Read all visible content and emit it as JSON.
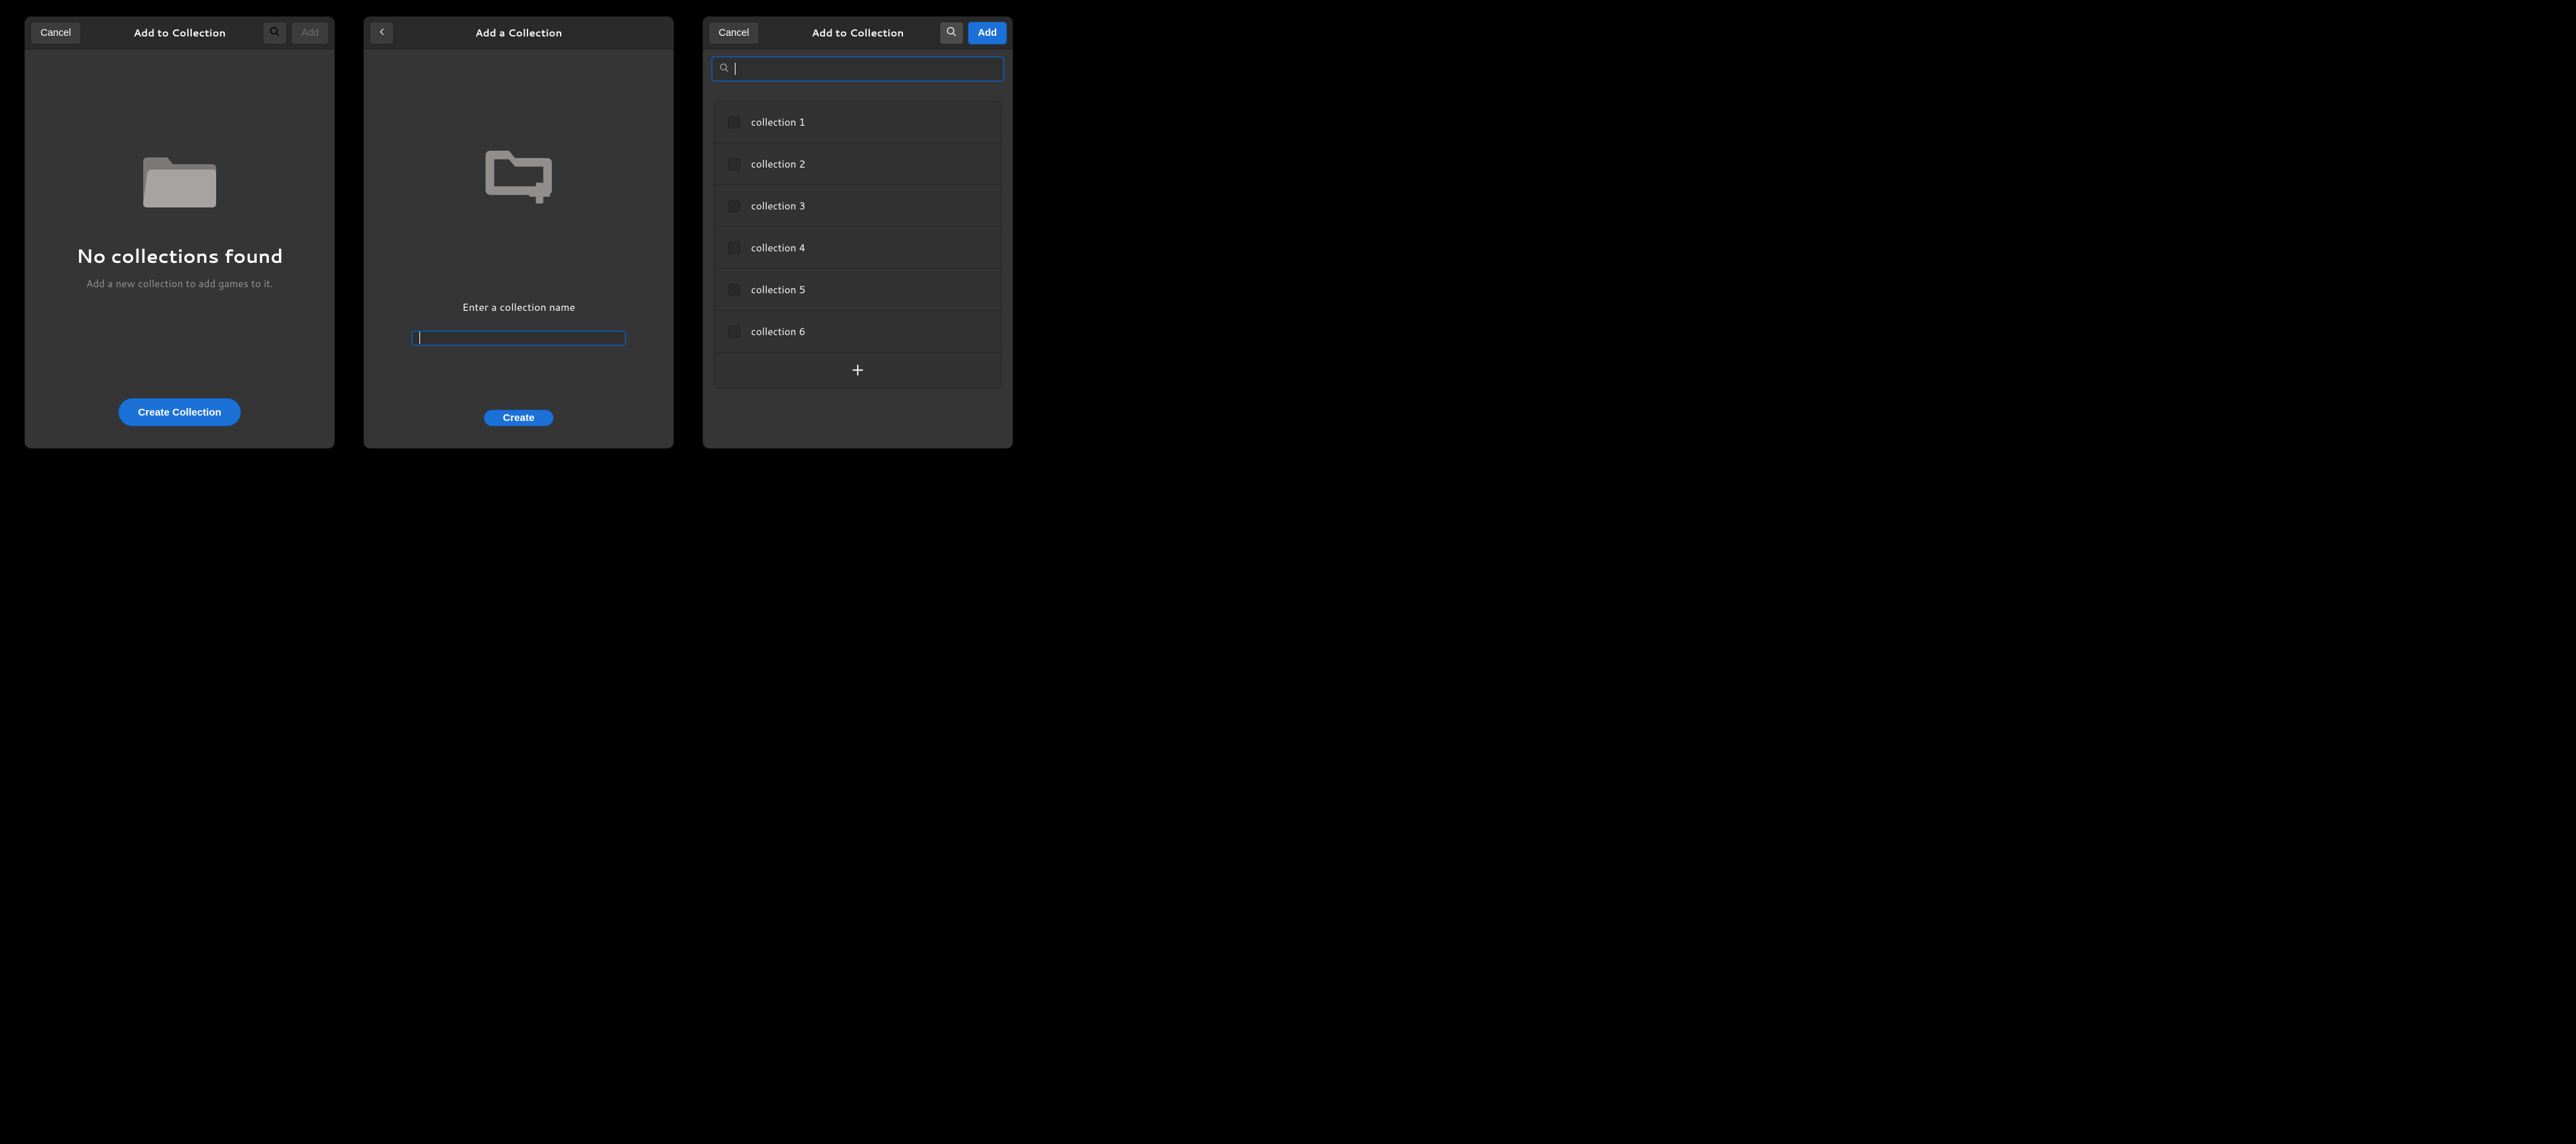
{
  "window1": {
    "header": {
      "cancel": "Cancel",
      "title": "Add to Collection",
      "add": "Add"
    },
    "empty": {
      "title": "No collections found",
      "subtitle": "Add a new collection to add games to it."
    },
    "create_button": "Create Collection"
  },
  "window2": {
    "header": {
      "title": "Add a Collection"
    },
    "prompt": "Enter a collection name",
    "input_value": "",
    "create_button": "Create"
  },
  "window3": {
    "header": {
      "cancel": "Cancel",
      "title": "Add to Collection",
      "add": "Add"
    },
    "search_value": "",
    "items": [
      {
        "label": "collection 1"
      },
      {
        "label": "collection 2"
      },
      {
        "label": "collection 3"
      },
      {
        "label": "collection 4"
      },
      {
        "label": "collection 5"
      },
      {
        "label": "collection 6"
      }
    ]
  }
}
